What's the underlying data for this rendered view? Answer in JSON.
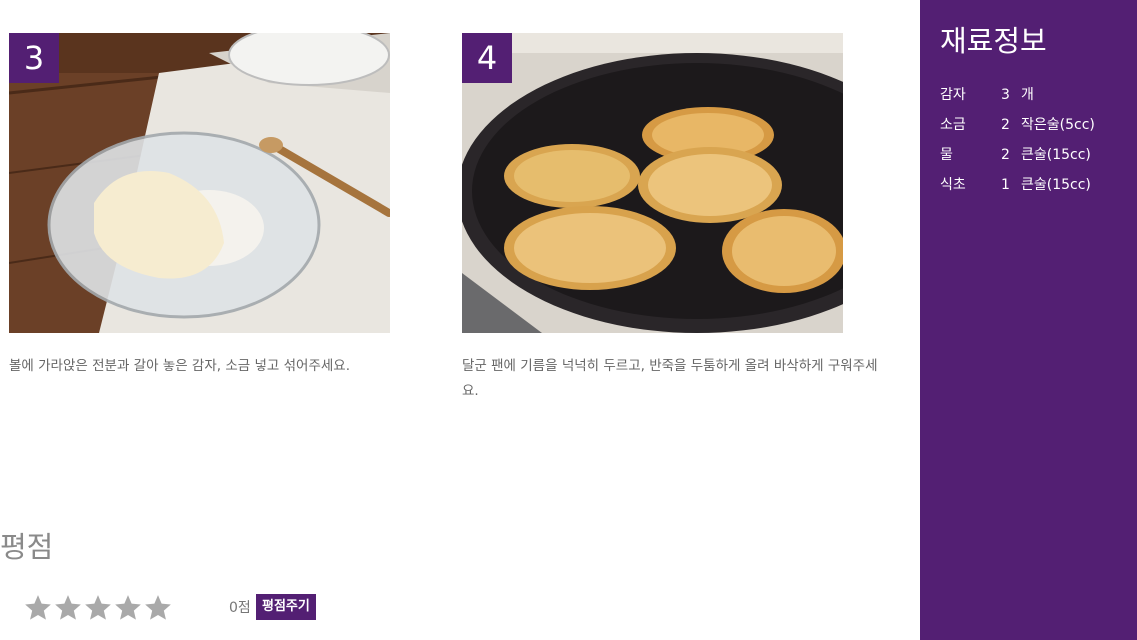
{
  "steps": [
    {
      "number": "3",
      "description": "볼에 가라앉은 전분과 갈아 놓은 감자, 소금 넣고 섞어주세요."
    },
    {
      "number": "4",
      "description": "달군 팬에 기름을 넉넉히 두르고, 반죽을 두툼하게 올려 바삭하게 구워주세요."
    }
  ],
  "rating": {
    "title": "평점",
    "score_text": "0점",
    "button_label": "평점주기",
    "stars_filled": 0,
    "stars_total": 5
  },
  "sidebar": {
    "title": "재료정보",
    "ingredients": [
      {
        "name": "감자",
        "qty": "3",
        "unit": "개"
      },
      {
        "name": "소금",
        "qty": "2",
        "unit": "작은술(5cc)"
      },
      {
        "name": "물",
        "qty": "2",
        "unit": "큰술(15cc)"
      },
      {
        "name": "식초",
        "qty": "1",
        "unit": "큰술(15cc)"
      }
    ]
  },
  "colors": {
    "accent": "#531f73",
    "star": "#a9a9a9"
  },
  "icons": {
    "star": "star-icon"
  }
}
